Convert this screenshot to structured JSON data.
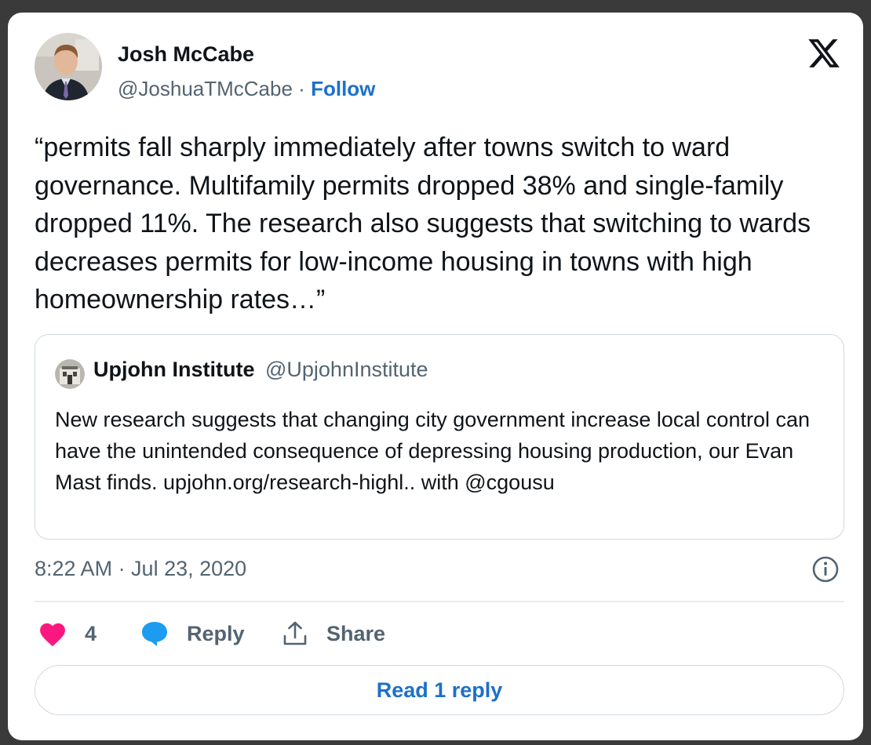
{
  "author": {
    "name": "Josh McCabe",
    "handle": "@JoshuaTMcCabe",
    "separator": "·",
    "follow_label": "Follow"
  },
  "tweet": {
    "text": "“permits fall sharply immediately after towns switch to ward governance. Multifamily permits dropped 38% and single-family dropped 11%. The research also suggests that switching to wards decreases permits for low-income housing in towns with high homeownership rates…”"
  },
  "quoted": {
    "name": "Upjohn Institute",
    "handle": "@UpjohnInstitute",
    "text": "New research suggests that changing city government increase local control can have the unintended consequence of depressing housing production, our Evan Mast finds. upjohn.org/research-highl.. with @cgousu"
  },
  "meta": {
    "timestamp": "8:22 AM · Jul 23, 2020"
  },
  "actions": {
    "like_count": "4",
    "reply_label": "Reply",
    "share_label": "Share"
  },
  "read_replies_label": "Read 1 reply",
  "colors": {
    "accent": "#1d70c9",
    "like": "#f91880",
    "reply_icon": "#1d9bf0",
    "secondary_text": "#536471",
    "border": "#cfd9de"
  },
  "icons": {
    "brand": "x-logo-icon",
    "like": "heart-icon",
    "reply": "speech-bubble-icon",
    "share": "share-upload-icon",
    "info": "info-icon"
  }
}
